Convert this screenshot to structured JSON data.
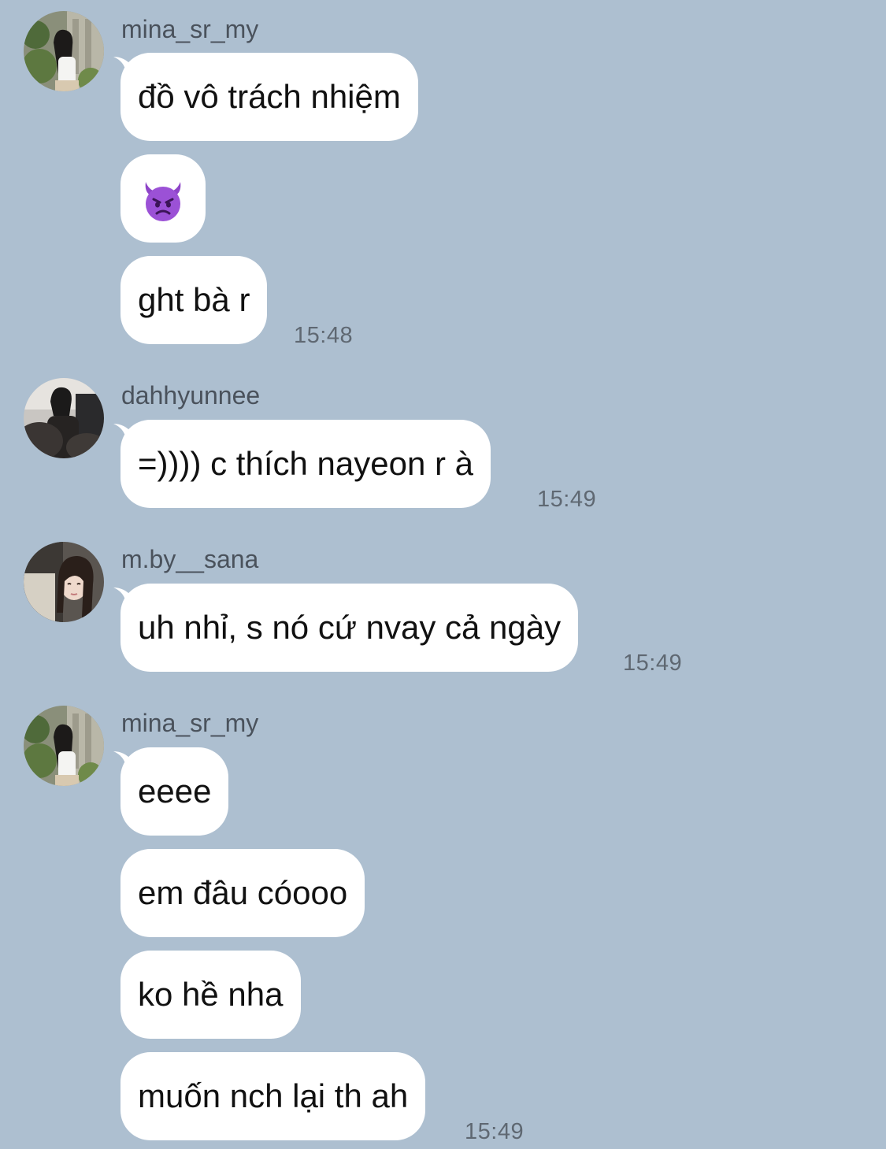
{
  "groups": [
    {
      "sender": "mina_sr_my",
      "avatar_icon": "mina-avatar",
      "messages": [
        "đồ vô trách nhiệm",
        "😈",
        "ght bà r"
      ],
      "time": "15:48"
    },
    {
      "sender": "dahhyunnee",
      "avatar_icon": "dahhyunnee-avatar",
      "messages": [
        "=)))) c thích nayeon r à"
      ],
      "time": "15:49"
    },
    {
      "sender": "m.by__sana",
      "avatar_icon": "sana-avatar",
      "messages": [
        "uh nhỉ, s nó cứ nvay cả ngày"
      ],
      "time": "15:49"
    },
    {
      "sender": "mina_sr_my",
      "avatar_icon": "mina-avatar",
      "messages": [
        "eeee",
        "em đâu cóooo",
        "ko hề nha",
        "muốn nch lại th ah"
      ],
      "time": "15:49"
    }
  ],
  "colors": {
    "background": "#adbfd0",
    "bubble": "#ffffff",
    "username": "#4a525c",
    "timestamp": "#5f6872"
  }
}
